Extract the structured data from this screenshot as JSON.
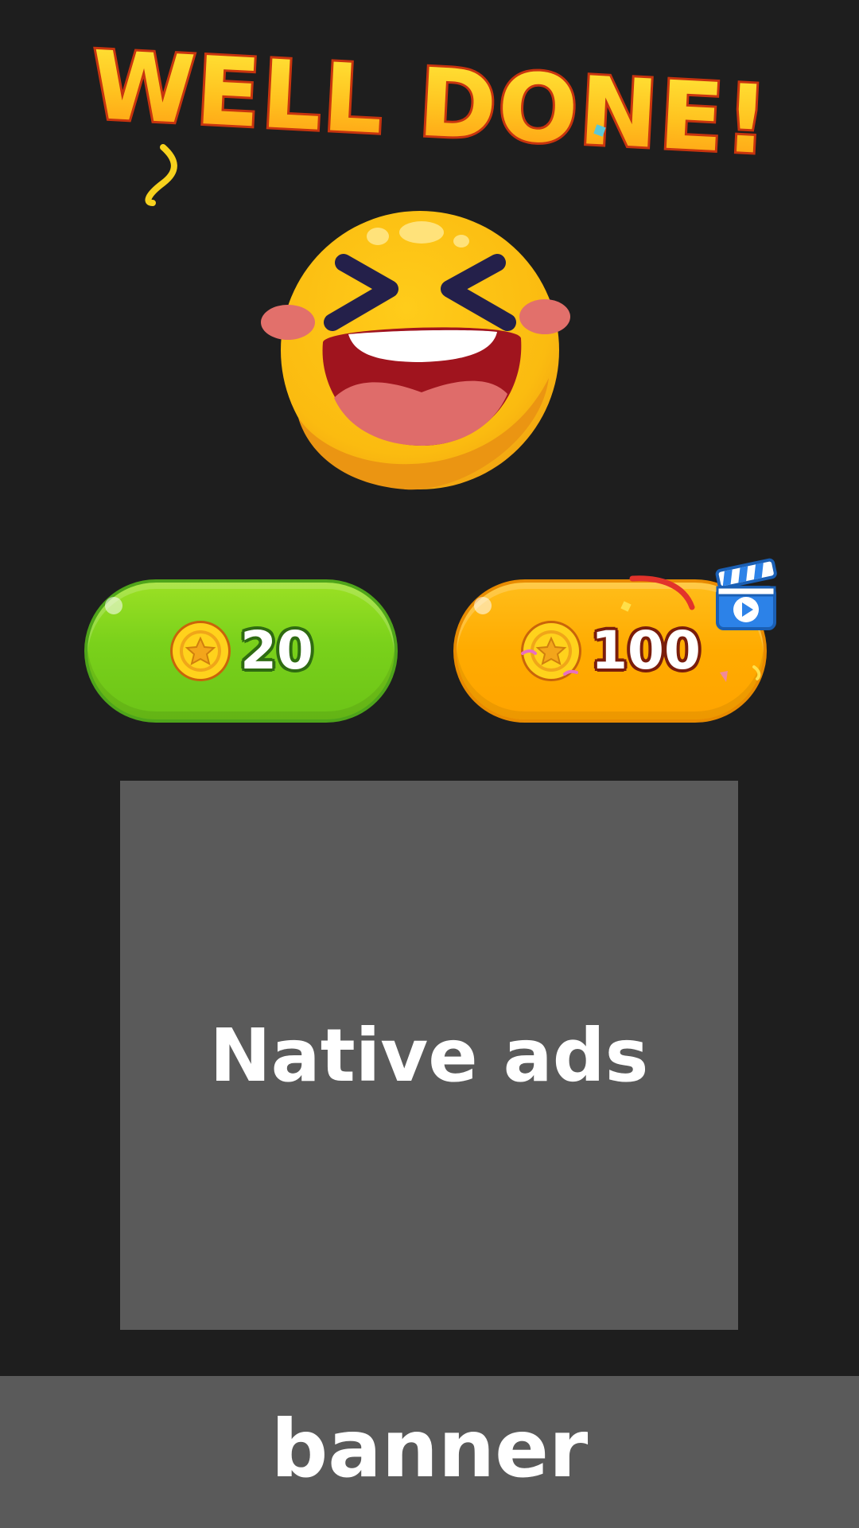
{
  "title": "WELL DONE!",
  "emoji": "laughing-face",
  "rewards": [
    {
      "amount": "20",
      "icon": "coin-icon",
      "color": "#7ad11b"
    },
    {
      "amount": "100",
      "icon": "coin-icon",
      "color": "#ffab00",
      "badge": "video-ad-icon"
    }
  ],
  "native_ads": {
    "label": "Native ads"
  },
  "banner": {
    "label": "banner"
  },
  "colors": {
    "background": "#1e1e1e",
    "placeholder": "#5a5a5a",
    "title_fill_top": "#ffe93a",
    "title_fill_bottom": "#ff9e12",
    "title_outline": "#c8340e"
  }
}
